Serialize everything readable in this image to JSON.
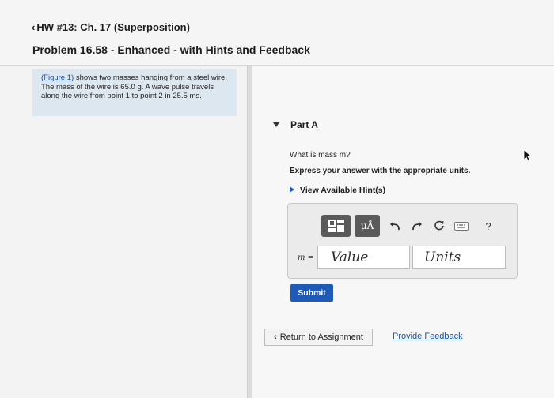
{
  "header": {
    "breadcrumb": "HW #13: Ch. 17 (Superposition)",
    "problem_title": "Problem 16.58 - Enhanced - with Hints and Feedback"
  },
  "figure_panel": {
    "link_text": "(Figure 1)",
    "text": " shows two masses hanging from a steel wire. The mass of the wire is 65.0 g. A wave pulse travels along the wire from point 1 to point 2 in 25.5 ms."
  },
  "part": {
    "label": "Part A",
    "question": "What is mass m?",
    "instructions": "Express your answer with the appropriate units.",
    "hint_link": "View Available Hint(s)"
  },
  "answer": {
    "variable_label": "m =",
    "value_placeholder": "Value",
    "units_placeholder": "Units"
  },
  "toolbar": {
    "mu_label": "μÅ",
    "help_label": "?",
    "keyboard_label": "kbd"
  },
  "buttons": {
    "submit": "Submit",
    "return": "Return to Assignment",
    "feedback": "Provide Feedback"
  },
  "colors": {
    "accent": "#1e5bb8",
    "figure_panel_bg": "#dde7ef",
    "toolbar_button": "#5a5a5a"
  }
}
